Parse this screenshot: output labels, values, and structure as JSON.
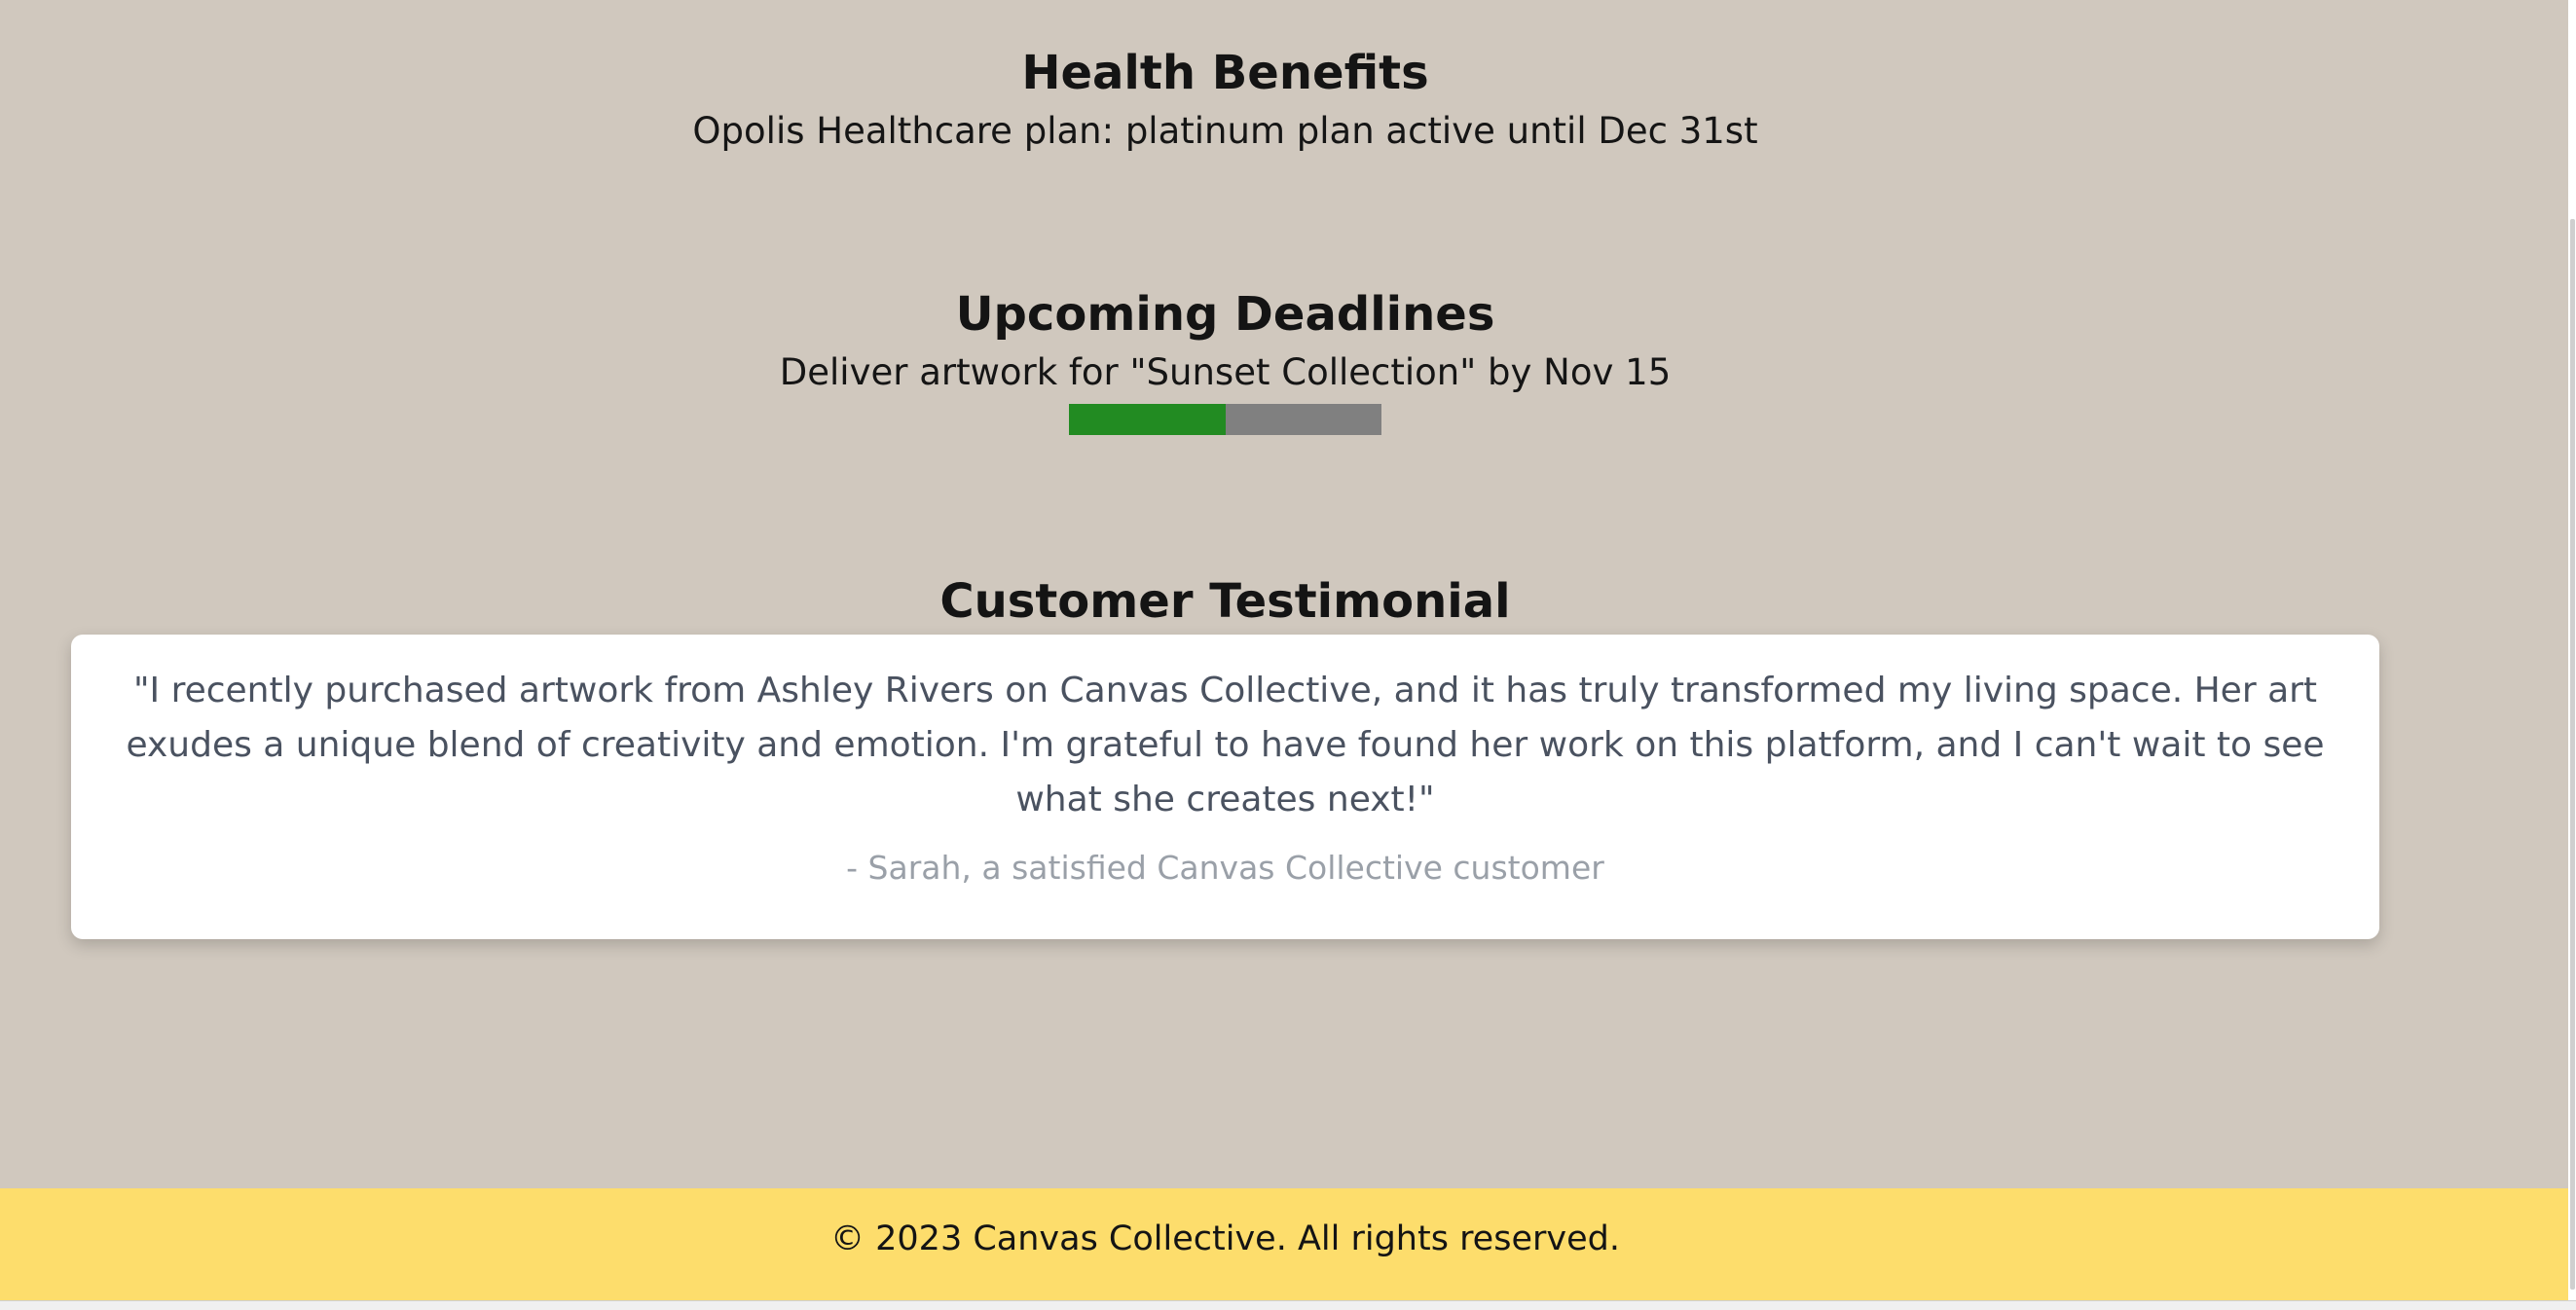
{
  "health": {
    "title": "Health Benefits",
    "text": "Opolis Healthcare plan: platinum plan active until Dec 31st"
  },
  "deadlines": {
    "title": "Upcoming Deadlines",
    "text": "Deliver artwork for \"Sunset Collection\" by Nov 15",
    "progress_fraction": 0.5,
    "progress_fill_color": "#228b22",
    "progress_track_color": "#808080"
  },
  "testimonial": {
    "title": "Customer Testimonial",
    "quote": "\"I recently purchased artwork from Ashley Rivers on Canvas Collective, and it has truly transformed my living space. Her art exudes a unique blend of creativity and emotion. I'm grateful to have found her work on this platform, and I can't wait to see what she creates next!\"",
    "author": "- Sarah, a satisfied Canvas Collective customer"
  },
  "footer": {
    "text": "© 2023 Canvas Collective. All rights reserved."
  },
  "colors": {
    "page_background": "#d0c8be",
    "footer_background": "#fddd6c",
    "card_background": "#ffffff"
  }
}
